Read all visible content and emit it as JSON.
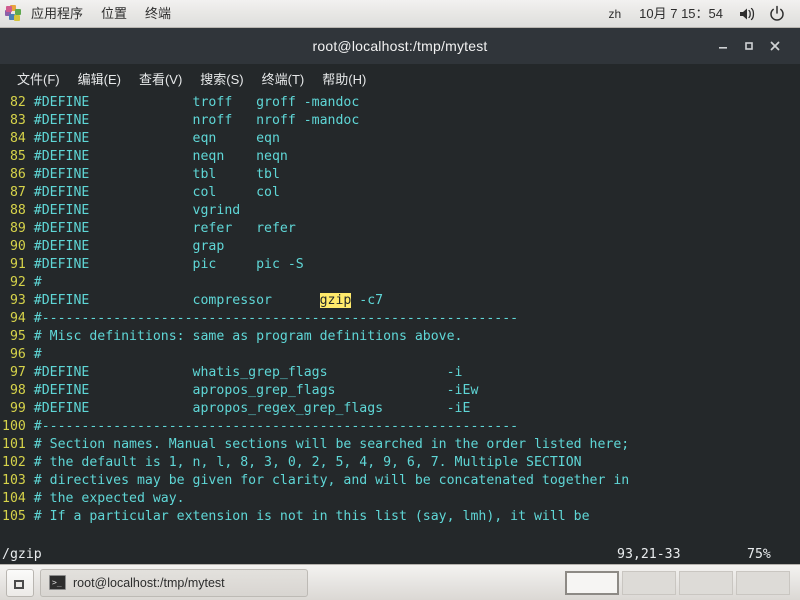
{
  "top_panel": {
    "apps_icon": "applications-pinwheel-icon",
    "menus": [
      {
        "label": "应用程序",
        "name": "panel-menu-applications"
      },
      {
        "label": "位置",
        "name": "panel-menu-places"
      },
      {
        "label": "终端",
        "name": "panel-menu-terminal"
      }
    ],
    "input_method": "zh",
    "clock": "10月 7 15：54",
    "volume_icon": "speaker-volume-icon",
    "power_icon": "power-icon"
  },
  "window": {
    "title": "root@localhost:/tmp/mytest",
    "buttons": {
      "minimize": "minimize-icon",
      "maximize": "maximize-icon",
      "close": "close-icon"
    },
    "menubar": [
      {
        "label": "文件(F)",
        "name": "menu-file"
      },
      {
        "label": "编辑(E)",
        "name": "menu-edit"
      },
      {
        "label": "查看(V)",
        "name": "menu-view"
      },
      {
        "label": "搜索(S)",
        "name": "menu-search"
      },
      {
        "label": "终端(T)",
        "name": "menu-terminal"
      },
      {
        "label": "帮助(H)",
        "name": "menu-help"
      }
    ]
  },
  "editor": {
    "colors": {
      "background": "#24282a",
      "text": "#5fd7d7",
      "line_number": "#d6d34a",
      "search_highlight_bg": "#ffea6b",
      "search_highlight_fg": "#24282a"
    },
    "lines": [
      {
        "num": "82",
        "text": "#DEFINE\t\ttroff\tgroff -mandoc"
      },
      {
        "num": "83",
        "text": "#DEFINE\t\tnroff\tnroff -mandoc"
      },
      {
        "num": "84",
        "text": "#DEFINE\t\teqn\teqn"
      },
      {
        "num": "85",
        "text": "#DEFINE\t\tneqn\tneqn"
      },
      {
        "num": "86",
        "text": "#DEFINE\t\ttbl\ttbl"
      },
      {
        "num": "87",
        "text": "#DEFINE\t\tcol\tcol"
      },
      {
        "num": "88",
        "text": "#DEFINE\t\tvgrind"
      },
      {
        "num": "89",
        "text": "#DEFINE\t\trefer\trefer"
      },
      {
        "num": "90",
        "text": "#DEFINE\t\tgrap"
      },
      {
        "num": "91",
        "text": "#DEFINE\t\tpic\tpic -S"
      },
      {
        "num": "92",
        "text": "#"
      },
      {
        "num": "93",
        "pre": "#DEFINE\t\tcompressor\t",
        "highlight": "gzip",
        "post": " -c7"
      },
      {
        "num": "94",
        "text": "#------------------------------------------------------------"
      },
      {
        "num": "95",
        "text": "# Misc definitions: same as program definitions above."
      },
      {
        "num": "96",
        "text": "#"
      },
      {
        "num": "97",
        "text": "#DEFINE\t\twhatis_grep_flags\t\t-i"
      },
      {
        "num": "98",
        "text": "#DEFINE\t\tapropos_grep_flags\t\t-iEw"
      },
      {
        "num": "99",
        "text": "#DEFINE\t\tapropos_regex_grep_flags\t-iE"
      },
      {
        "num": "100",
        "text": "#------------------------------------------------------------"
      },
      {
        "num": "101",
        "text": "# Section names. Manual sections will be searched in the order listed here;"
      },
      {
        "num": "102",
        "text": "# the default is 1, n, l, 8, 3, 0, 2, 5, 4, 9, 6, 7. Multiple SECTION"
      },
      {
        "num": "103",
        "text": "# directives may be given for clarity, and will be concatenated together in"
      },
      {
        "num": "104",
        "text": "# the expected way."
      },
      {
        "num": "105",
        "text": "# If a particular extension is not in this list (say, lmh), it will be"
      }
    ],
    "status": {
      "search_command": "/gzip",
      "position": "93,21-33",
      "percent": "75%"
    }
  },
  "taskbar": {
    "show_desktop_icon": "show-desktop-icon",
    "task": {
      "icon": "terminal-icon",
      "label": "root@localhost:/tmp/mytest"
    },
    "workspaces": [
      {
        "name": "workspace-1",
        "active": true
      },
      {
        "name": "workspace-2",
        "active": false
      },
      {
        "name": "workspace-3",
        "active": false
      },
      {
        "name": "workspace-4",
        "active": false
      }
    ]
  }
}
